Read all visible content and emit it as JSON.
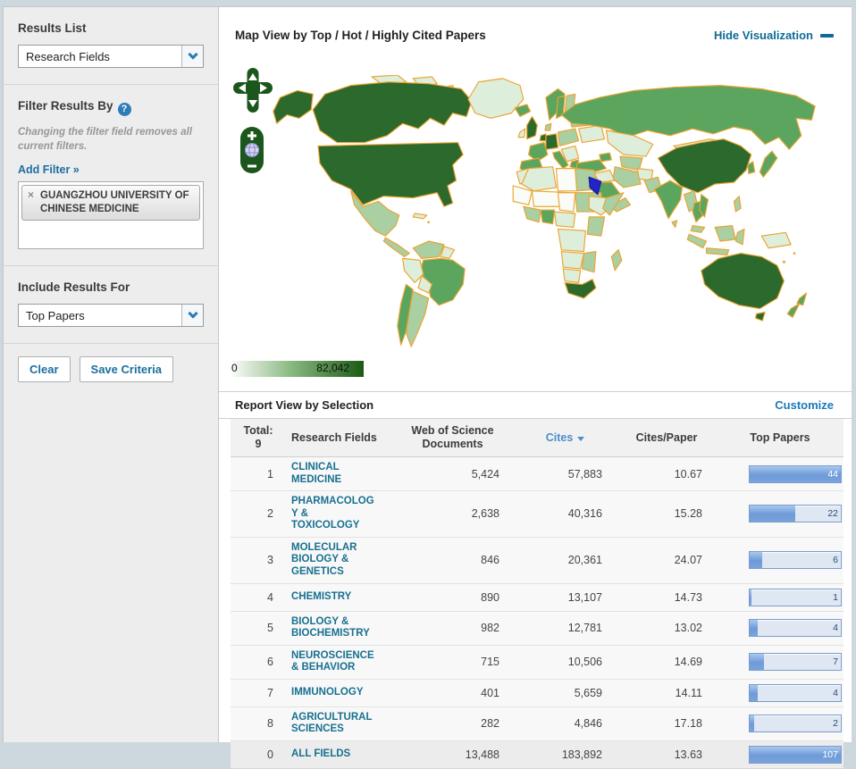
{
  "sidebar": {
    "results_list": {
      "label": "Results List",
      "selected": "Research Fields"
    },
    "filter": {
      "heading": "Filter Results By",
      "help_icon": "?",
      "note": "Changing the filter field removes all current filters.",
      "add_filter_label": "Add Filter »",
      "filters": [
        {
          "remove_icon": "×",
          "label": "GUANGZHOU UNIVERSITY OF CHINESE MEDICINE"
        }
      ]
    },
    "include_results": {
      "label": "Include Results For",
      "selected": "Top Papers"
    },
    "buttons": {
      "clear": "Clear",
      "save": "Save Criteria"
    }
  },
  "map_section": {
    "title": "Map View by Top / Hot / Highly Cited Papers",
    "hide_link": "Hide Visualization",
    "legend": {
      "min": "0",
      "max": "82,042"
    },
    "colors": {
      "low": "#ffffff",
      "high": "#1b5a14",
      "country_border": "#eca431",
      "highlight": "#2323cb"
    }
  },
  "report": {
    "title": "Report View by Selection",
    "customize_link": "Customize",
    "table": {
      "total_label": "Total:",
      "total_value": "9",
      "columns": [
        "Research Fields",
        "Web of Science Documents",
        "Cites",
        "Cites/Paper",
        "Top Papers"
      ],
      "sorted_by": "Cites",
      "sort_direction": "desc",
      "rows": [
        {
          "rank": "1",
          "field": "CLINICAL MEDICINE",
          "documents": "5,424",
          "cites": "57,883",
          "cites_per_paper": "10.67",
          "top_papers": 44
        },
        {
          "rank": "2",
          "field": "PHARMACOLOGY & TOXICOLOGY",
          "documents": "2,638",
          "cites": "40,316",
          "cites_per_paper": "15.28",
          "top_papers": 22
        },
        {
          "rank": "3",
          "field": "MOLECULAR BIOLOGY & GENETICS",
          "documents": "846",
          "cites": "20,361",
          "cites_per_paper": "24.07",
          "top_papers": 6
        },
        {
          "rank": "4",
          "field": "CHEMISTRY",
          "documents": "890",
          "cites": "13,107",
          "cites_per_paper": "14.73",
          "top_papers": 1
        },
        {
          "rank": "5",
          "field": "BIOLOGY & BIOCHEMISTRY",
          "documents": "982",
          "cites": "12,781",
          "cites_per_paper": "13.02",
          "top_papers": 4
        },
        {
          "rank": "6",
          "field": "NEUROSCIENCE & BEHAVIOR",
          "documents": "715",
          "cites": "10,506",
          "cites_per_paper": "14.69",
          "top_papers": 7
        },
        {
          "rank": "7",
          "field": "IMMUNOLOGY",
          "documents": "401",
          "cites": "5,659",
          "cites_per_paper": "14.11",
          "top_papers": 4
        },
        {
          "rank": "8",
          "field": "AGRICULTURAL SCIENCES",
          "documents": "282",
          "cites": "4,846",
          "cites_per_paper": "17.18",
          "top_papers": 2
        },
        {
          "rank": "0",
          "field": "ALL FIELDS",
          "documents": "13,488",
          "cites": "183,892",
          "cites_per_paper": "13.63",
          "top_papers": 107
        }
      ]
    }
  }
}
